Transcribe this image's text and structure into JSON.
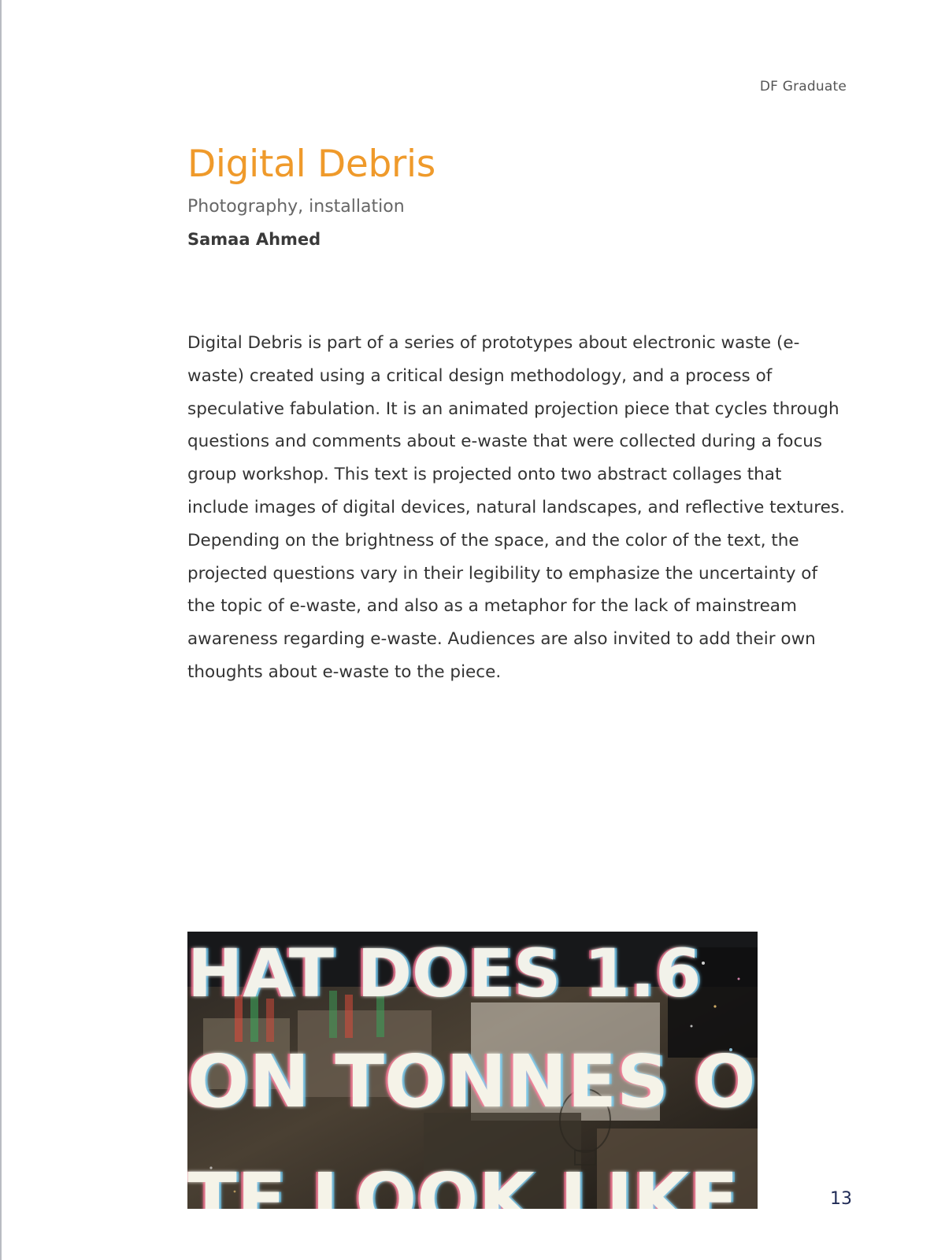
{
  "header": {
    "running_head": "DF Graduate"
  },
  "article": {
    "title": "Digital Debris",
    "subtitle": "Photography, installation",
    "author": "Samaa Ahmed",
    "body": "Digital Debris is part of a series of prototypes about electronic waste (e-waste) created using a critical design methodology, and a process of speculative fabulation. It is an animated projection piece that cycles through questions and comments about e-waste that were collected during a focus group workshop. This text is projected onto two abstract collages that include images of digital devices, natural landscapes, and reflective textures. Depending on the brightness of the space, and the color of the text, the projected questions vary in their legibility to emphasize the uncertainty of the topic of e-waste, and also as a metaphor for the lack of mainstream awareness regarding e-waste. Audiences are also invited to add their own thoughts about e-waste to the piece."
  },
  "image": {
    "lines": [
      "HAT DOES 1.6",
      "ON TONNES OF",
      "TE LOOK LIKE"
    ]
  },
  "footer": {
    "page_number": "13"
  },
  "colors": {
    "title": "#ef9a2b",
    "page_number": "#1f2a55",
    "body": "#333333"
  }
}
